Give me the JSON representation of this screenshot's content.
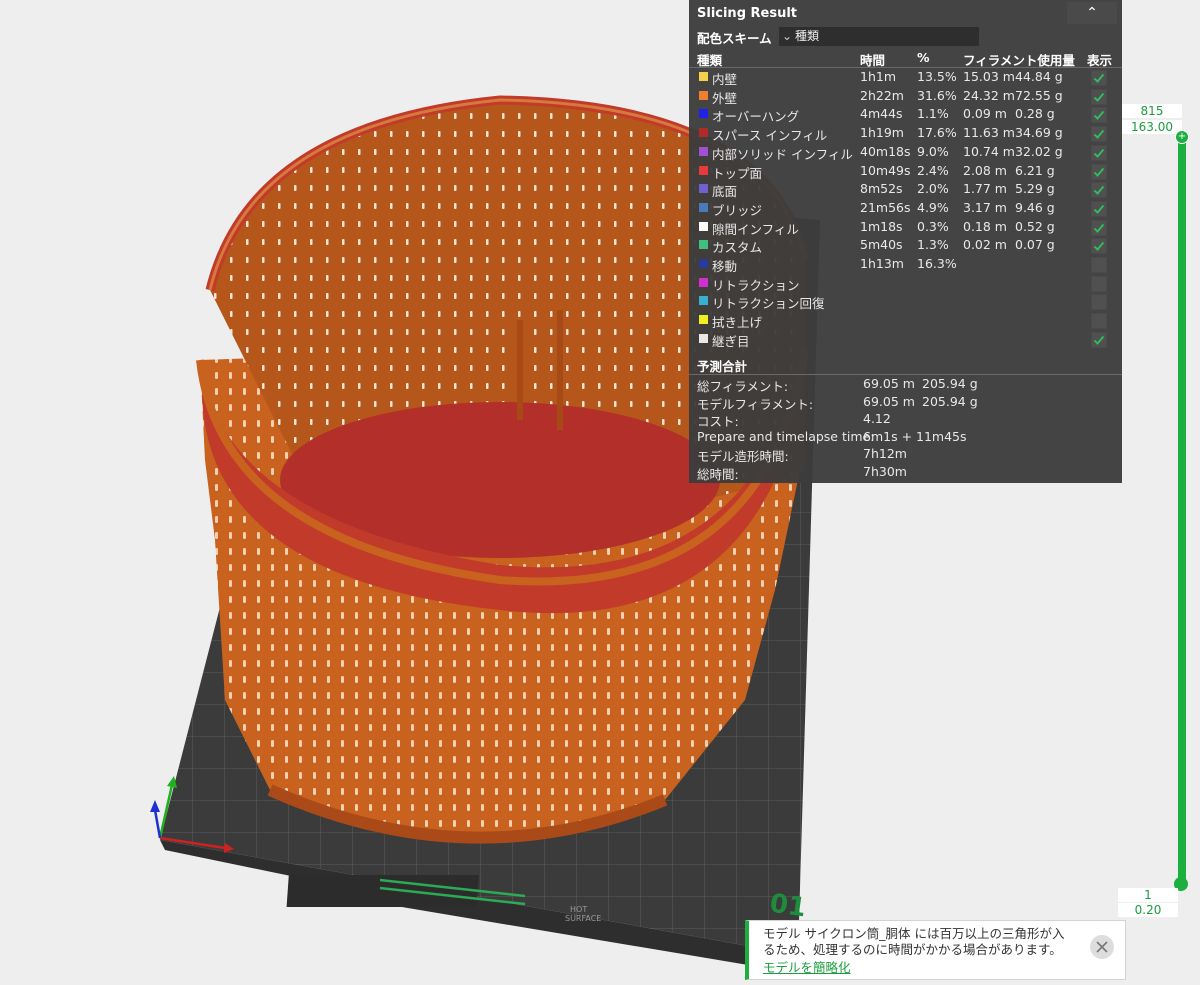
{
  "panel": {
    "title": "Slicing Result",
    "collapse_icon": "chevron-double-up-icon",
    "scheme_label": "配色スキーム",
    "scheme_value": "種類",
    "headers": {
      "type": "種類",
      "time": "時間",
      "percent": "%",
      "usage": "フィラメント使用量",
      "show": "表示"
    },
    "rows": [
      {
        "name": "内壁",
        "color": "#f5d24a",
        "time": "1h1m",
        "percent": "13.5%",
        "length": "15.03 m",
        "weight": "44.84 g",
        "shown": true
      },
      {
        "name": "外壁",
        "color": "#f08030",
        "time": "2h22m",
        "percent": "31.6%",
        "length": "24.32 m",
        "weight": "72.55 g",
        "shown": true
      },
      {
        "name": "オーバーハング",
        "color": "#1e22e8",
        "time": "4m44s",
        "percent": "1.1%",
        "length": "0.09 m",
        "weight": "0.28 g",
        "shown": true
      },
      {
        "name": "スパース インフィル",
        "color": "#b02a2a",
        "time": "1h19m",
        "percent": "17.6%",
        "length": "11.63 m",
        "weight": "34.69 g",
        "shown": true
      },
      {
        "name": "内部ソリッド インフィル",
        "color": "#a050d0",
        "time": "40m18s",
        "percent": "9.0%",
        "length": "10.74 m",
        "weight": "32.02 g",
        "shown": true
      },
      {
        "name": "トップ面",
        "color": "#e83a3a",
        "time": "10m49s",
        "percent": "2.4%",
        "length": "2.08 m",
        "weight": "6.21 g",
        "shown": true
      },
      {
        "name": "底面",
        "color": "#7060d0",
        "time": "8m52s",
        "percent": "2.0%",
        "length": "1.77 m",
        "weight": "5.29 g",
        "shown": true
      },
      {
        "name": "ブリッジ",
        "color": "#4a7ab8",
        "time": "21m56s",
        "percent": "4.9%",
        "length": "3.17 m",
        "weight": "9.46 g",
        "shown": true
      },
      {
        "name": "隙間インフィル",
        "color": "#ffffff",
        "time": "1m18s",
        "percent": "0.3%",
        "length": "0.18 m",
        "weight": "0.52 g",
        "shown": true
      },
      {
        "name": "カスタム",
        "color": "#40c080",
        "time": "5m40s",
        "percent": "1.3%",
        "length": "0.02 m",
        "weight": "0.07 g",
        "shown": true
      },
      {
        "name": "移動",
        "color": "#2a3a9a",
        "time": "1h13m",
        "percent": "16.3%",
        "length": "",
        "weight": "",
        "shown": false
      },
      {
        "name": "リトラクション",
        "color": "#d030d0",
        "time": "",
        "percent": "",
        "length": "",
        "weight": "",
        "shown": false
      },
      {
        "name": "リトラクション回復",
        "color": "#3ab0d0",
        "time": "",
        "percent": "",
        "length": "",
        "weight": "",
        "shown": false
      },
      {
        "name": "拭き上げ",
        "color": "#f0f020",
        "time": "",
        "percent": "",
        "length": "",
        "weight": "",
        "shown": false
      },
      {
        "name": "継ぎ目",
        "color": "#e8e8e8",
        "time": "",
        "percent": "",
        "length": "",
        "weight": "",
        "shown": true
      }
    ],
    "estimate_title": "予測合計",
    "estimates": [
      {
        "label": "総フィラメント:",
        "value": "69.05 m",
        "value2": "205.94 g"
      },
      {
        "label": "モデルフィラメント:",
        "value": "69.05 m",
        "value2": "205.94 g"
      },
      {
        "label": "コスト:",
        "value": "4.12",
        "value2": ""
      },
      {
        "label": "Prepare and timelapse time:",
        "value": "6m1s + 11m45s",
        "value2": ""
      },
      {
        "label": "モデル造形時間:",
        "value": "7h12m",
        "value2": ""
      },
      {
        "label": "総時間:",
        "value": "7h30m",
        "value2": ""
      }
    ]
  },
  "layer_slider": {
    "top_layer": "815",
    "top_height": "163.00",
    "bottom_layer": "1",
    "bottom_height": "0.20",
    "accent": "#1cae3e"
  },
  "plate": {
    "number": "01",
    "surface_label_1": "HOT",
    "surface_label_2": "SURFACE"
  },
  "toast": {
    "message": "モデル サイクロン筒_胴体 には百万以上の三角形が入るため、処理するのに時間がかかる場合があります。",
    "link": "モデルを簡略化",
    "close_icon": "close-icon"
  },
  "colors": {
    "model_orange": "#c8621e",
    "model_red": "#b3302a",
    "bed_dark": "#3c3c3c",
    "grid": "#5a5a5a"
  }
}
